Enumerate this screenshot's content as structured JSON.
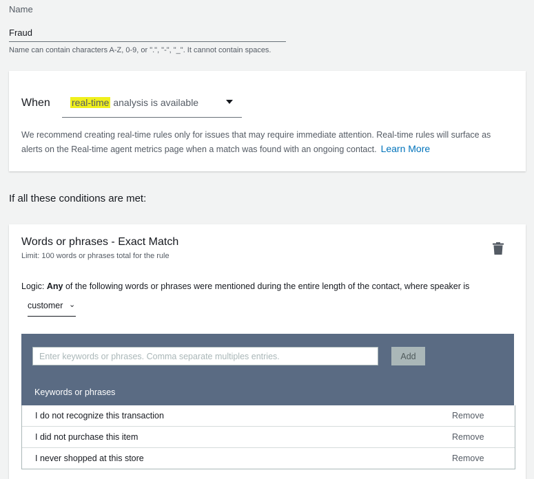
{
  "name_field": {
    "label": "Name",
    "value": "Fraud",
    "help": "Name can contain characters A-Z, 0-9, or \".\", \"-\", \"_\". It cannot contain spaces."
  },
  "when_card": {
    "label": "When",
    "select_highlighted": "real-time",
    "select_rest": " analysis is available",
    "highlight_color": "#f0f01c",
    "description": "We recommend creating real-time rules only for issues that may require immediate attention. Real-time rules will surface as alerts on the Real-time agent metrics page when a match was found with an ongoing contact.",
    "learn_more": "Learn More"
  },
  "conditions_heading": "If all these conditions are met:",
  "words_card": {
    "title": "Words or phrases - Exact Match",
    "limit": "Limit: 100 words or phrases total for the rule",
    "logic_prefix": "Logic: ",
    "logic_bold": "Any",
    "logic_rest": " of the following words or phrases were mentioned during the entire length of the contact, where speaker is",
    "speaker": "customer",
    "delete_icon": "trash-icon",
    "keyword_input_placeholder": "Enter keywords or phrases. Comma separate multiples entries.",
    "add_label": "Add",
    "table_header": "Keywords or phrases",
    "rows": [
      {
        "text": "I do not recognize this transaction",
        "action": "Remove"
      },
      {
        "text": "I did not purchase this item",
        "action": "Remove"
      },
      {
        "text": "I never shopped at this store",
        "action": "Remove"
      }
    ]
  },
  "colors": {
    "page_bg": "#f2f3f3",
    "panel_bg": "#5a6b83",
    "link": "#0073bb"
  }
}
